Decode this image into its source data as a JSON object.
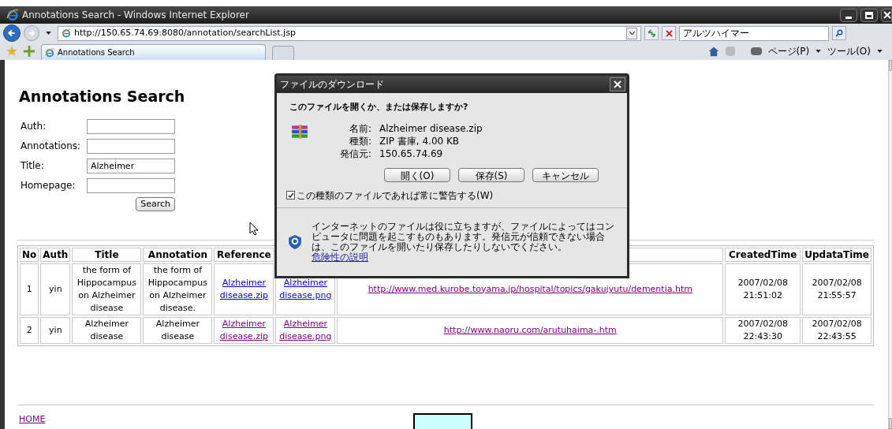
{
  "window": {
    "title": "Annotations Search - Windows Internet Explorer"
  },
  "address_bar": {
    "url": "http://150.65.74.69:8080/annotation/searchList.jsp"
  },
  "search_box": {
    "value": "アルツハイマー"
  },
  "tabs": [
    {
      "label": "Annotations Search",
      "selected": true
    }
  ],
  "command_bar": [
    "ページ(P)",
    "ツール(O)"
  ],
  "page": {
    "heading": "Annotations Search",
    "form": [
      {
        "label": "Auth:"
      },
      {
        "label": "Annotations:"
      },
      {
        "label": "Title:",
        "value": "Alzheimer"
      },
      {
        "label": "Homepage:"
      }
    ],
    "search_button": "Search",
    "table": {
      "columns": [
        "No",
        "Auth",
        "Title",
        "Annotation",
        "Reference",
        "CreatedTime",
        "UpdataTime"
      ],
      "rows": [
        {
          "no": "1",
          "auth": "yin",
          "title": "the form of Hippocampus on Alzheimer disease",
          "annotation": "the form of Hippocampus on Alzheimer disease.",
          "reference": {
            "text": "Alzheimer disease.zip",
            "visited": false
          },
          "image": {
            "text": "Alzheimer disease.png",
            "visited": false
          },
          "url": {
            "text": "http://www.med.kurobe.toyama.jp/hospital/topics/gakujyutu/dementia.htm",
            "visited": true
          },
          "created": "2007/02/08 21:51:02",
          "updated": "2007/02/08 21:55:57"
        },
        {
          "no": "2",
          "auth": "yin",
          "title": "Alzheimer disease",
          "annotation": "Alzheimer disease",
          "reference": {
            "text": "Alzheimer disease.zip",
            "visited": true
          },
          "image": {
            "text": "Alzheimer disease.png",
            "visited": true
          },
          "url": {
            "text": "http://www.naoru.com/arutuhaima-.htm",
            "visited": true
          },
          "created": "2007/02/08 22:43:30",
          "updated": "2007/02/08 22:43:55"
        }
      ]
    },
    "home_link": "HOME"
  },
  "dialog": {
    "title": "ファイルのダウンロード",
    "question": "このファイルを開くか、または保存しますか?",
    "fields": [
      {
        "label": "名前:",
        "value": "Alzheimer disease.zip"
      },
      {
        "label": "種類:",
        "value": "ZIP 書庫, 4.00 KB"
      },
      {
        "label": "発信元:",
        "value": "150.65.74.69"
      }
    ],
    "buttons": [
      "開く(O)",
      "保存(S)",
      "キャンセル"
    ],
    "checkbox": {
      "label": "この種類のファイルであれば常に警告する(W)",
      "checked": true
    },
    "warning": "インターネットのファイルは役に立ちますが、ファイルによってはコンピュータに問題を起こすものもあります。発信元が信頼できない場合は、このファイルを開いたり保存したりしないでください。",
    "warning_link": "危険性の説明"
  }
}
